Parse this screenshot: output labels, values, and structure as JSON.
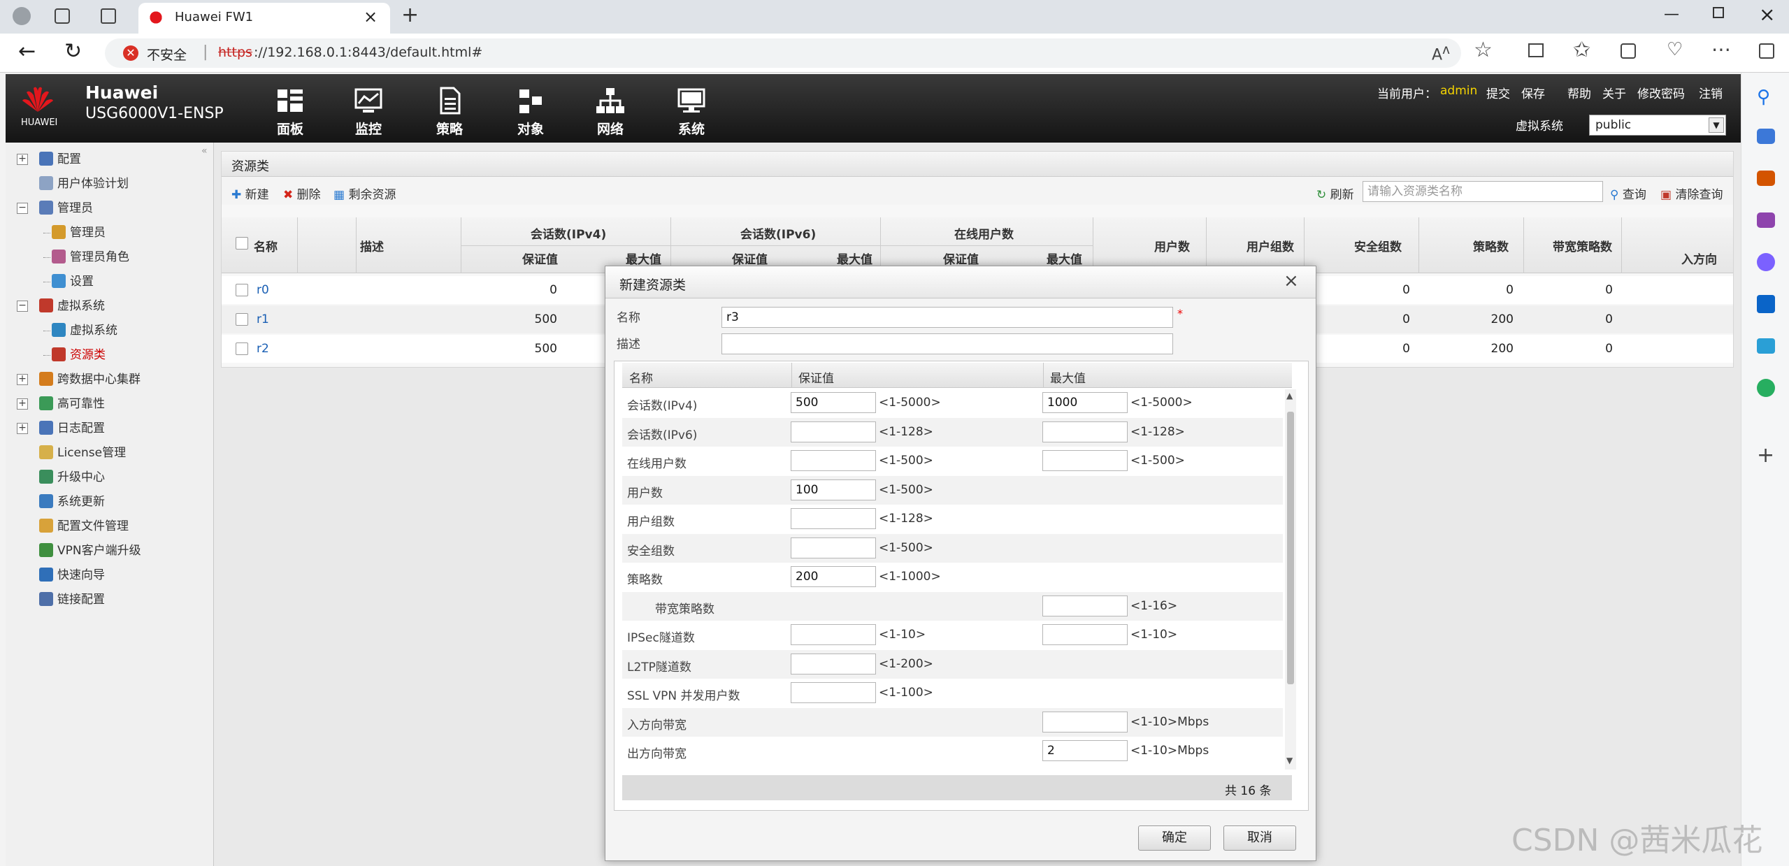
{
  "browser": {
    "tab_title": "Huawei FW1",
    "security_label": "不安全",
    "url_scheme": "https",
    "url_rest": "://192.168.0.1:8443/default.html#"
  },
  "app": {
    "brand": "HUAWEI",
    "product_name": "Huawei",
    "model": "USG6000V1-ENSP",
    "nav": [
      "面板",
      "监控",
      "策略",
      "对象",
      "网络",
      "系统"
    ],
    "current_user_label": "当前用户：",
    "current_user": "admin",
    "links": [
      "提交",
      "保存",
      "帮助",
      "关于",
      "修改密码",
      "注销"
    ],
    "vsys_label": "虚拟系统",
    "vsys_value": "public"
  },
  "tree": [
    {
      "label": "配置",
      "level": 0,
      "expander": "+"
    },
    {
      "label": "用户体验计划",
      "level": 0
    },
    {
      "label": "管理员",
      "level": 0,
      "expander": "−"
    },
    {
      "label": "管理员",
      "level": 1
    },
    {
      "label": "管理员角色",
      "level": 1
    },
    {
      "label": "设置",
      "level": 1
    },
    {
      "label": "虚拟系统",
      "level": 0,
      "expander": "−"
    },
    {
      "label": "虚拟系统",
      "level": 1
    },
    {
      "label": "资源类",
      "level": 1,
      "selected": true
    },
    {
      "label": "跨数据中心集群",
      "level": 0,
      "expander": "+"
    },
    {
      "label": "高可靠性",
      "level": 0,
      "expander": "+"
    },
    {
      "label": "日志配置",
      "level": 0,
      "expander": "+"
    },
    {
      "label": "License管理",
      "level": 0
    },
    {
      "label": "升级中心",
      "level": 0
    },
    {
      "label": "系统更新",
      "level": 0
    },
    {
      "label": "配置文件管理",
      "level": 0
    },
    {
      "label": "VPN客户端升级",
      "level": 0
    },
    {
      "label": "快速向导",
      "level": 0
    },
    {
      "label": "链接配置",
      "level": 0
    }
  ],
  "panel": {
    "title": "资源类",
    "toolbar": {
      "new": "新建",
      "delete": "删除",
      "remaining": "剩余资源",
      "refresh": "刷新",
      "search_placeholder": "请输入资源类名称",
      "query": "查询",
      "clear": "清除查询"
    },
    "groups": [
      "会话数(IPv4)",
      "会话数(IPv6)",
      "在线用户数"
    ],
    "columns": [
      "名称",
      "描述",
      "保证值",
      "最大值",
      "保证值",
      "最大值",
      "保证值",
      "最大值",
      "用户数",
      "用户组数",
      "安全组数",
      "策略数",
      "带宽策略数",
      "入方向"
    ],
    "rows": [
      {
        "name": "r0",
        "ipv4_guarantee": "0",
        "sec_groups": "0",
        "policies": "0",
        "bw_policies": "0"
      },
      {
        "name": "r1",
        "ipv4_guarantee": "500",
        "sec_groups": "0",
        "policies": "200",
        "bw_policies": "0"
      },
      {
        "name": "r2",
        "ipv4_guarantee": "500",
        "sec_groups": "0",
        "policies": "200",
        "bw_policies": "0"
      }
    ]
  },
  "dialog": {
    "title": "新建资源类",
    "name_label": "名称",
    "name_value": "r3",
    "desc_label": "描述",
    "desc_value": "",
    "col_name": "名称",
    "col_guarantee": "保证值",
    "col_max": "最大值",
    "rows": [
      {
        "label": "会话数(IPv4)",
        "g": "500",
        "g_range": "<1-5000>",
        "m": "1000",
        "m_range": "<1-5000>"
      },
      {
        "label": "会话数(IPv6)",
        "g": "",
        "g_range": "<1-128>",
        "m": "",
        "m_range": "<1-128>"
      },
      {
        "label": "在线用户数",
        "g": "",
        "g_range": "<1-500>",
        "m": "",
        "m_range": "<1-500>"
      },
      {
        "label": "用户数",
        "g": "100",
        "g_range": "<1-500>"
      },
      {
        "label": "用户组数",
        "g": "",
        "g_range": "<1-128>"
      },
      {
        "label": "安全组数",
        "g": "",
        "g_range": "<1-500>"
      },
      {
        "label": "策略数",
        "g": "200",
        "g_range": "<1-1000>"
      },
      {
        "label": "带宽策略数",
        "indent": true,
        "m": "",
        "m_range": "<1-16>"
      },
      {
        "label": "IPSec隧道数",
        "g": "",
        "g_range": "<1-10>",
        "m": "",
        "m_range": "<1-10>"
      },
      {
        "label": "L2TP隧道数",
        "g": "",
        "g_range": "<1-200>"
      },
      {
        "label": "SSL VPN 并发用户数",
        "g": "",
        "g_range": "<1-100>"
      },
      {
        "label": "入方向带宽",
        "m": "",
        "m_range": "<1-10>Mbps"
      },
      {
        "label": "出方向带宽",
        "m": "2",
        "m_range": "<1-10>Mbps"
      }
    ],
    "total": "共 16 条",
    "ok": "确定",
    "cancel": "取消"
  },
  "watermark": "CSDN @茜米瓜花"
}
